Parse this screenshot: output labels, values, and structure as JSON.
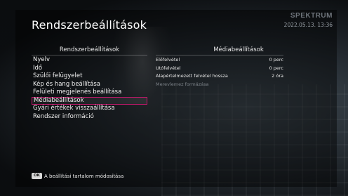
{
  "header": {
    "title": "Rendszerbeállítások",
    "brand": "SPEKTRUM",
    "datetime": "2022.05.13. 13:36"
  },
  "left_panel": {
    "heading": "Rendszerbeállítások",
    "items": [
      {
        "label": "Nyelv"
      },
      {
        "label": "Idő"
      },
      {
        "label": "Szülői felügyelet"
      },
      {
        "label": "Kép és hang beállítása"
      },
      {
        "label": "Felületi megjelenés beállítása"
      },
      {
        "label": "Médiabeállítások"
      },
      {
        "label": "Gyári értékek visszaállítása"
      },
      {
        "label": "Rendszer információ"
      }
    ],
    "selected_index": 5
  },
  "right_panel": {
    "heading": "Médiabeállítások",
    "rows": [
      {
        "label": "Előfelvétel",
        "value": "0 perc"
      },
      {
        "label": "Utófelvétel",
        "value": "0 perc"
      },
      {
        "label": "Alapértelmezett felvétel hossza",
        "value": "2 óra"
      },
      {
        "label": "Merevlemez formázása",
        "value": ""
      }
    ]
  },
  "footer": {
    "key": "OK",
    "hint": "A beállítási tartalom módosítása"
  },
  "colors": {
    "selection": "#c2186b"
  }
}
